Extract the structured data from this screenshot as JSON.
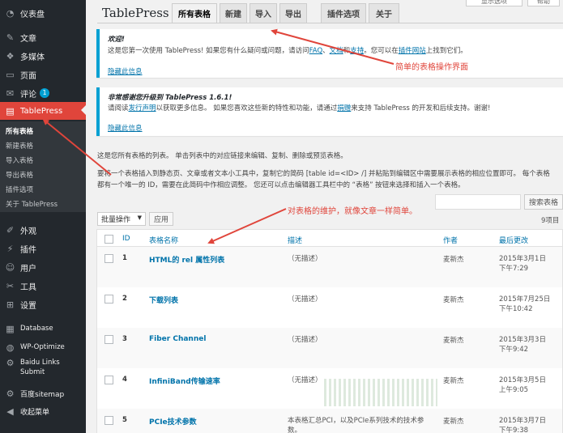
{
  "sidebar": {
    "items": [
      {
        "label": "仪表盘",
        "icon": "dashboard-icon",
        "glyph": "◔"
      },
      {
        "label": "文章",
        "icon": "pin-icon",
        "glyph": "✎"
      },
      {
        "label": "多媒体",
        "icon": "media-icon",
        "glyph": "❖"
      },
      {
        "label": "页面",
        "icon": "page-icon",
        "glyph": "▭"
      },
      {
        "label": "评论",
        "icon": "comment-icon",
        "glyph": "✉",
        "badge": "1"
      },
      {
        "label": "TablePress",
        "icon": "table-icon",
        "glyph": "▤"
      },
      {
        "label": "外观",
        "icon": "brush-icon",
        "glyph": "✐"
      },
      {
        "label": "插件",
        "icon": "plugin-icon",
        "glyph": "⚡"
      },
      {
        "label": "用户",
        "icon": "user-icon",
        "glyph": "☺"
      },
      {
        "label": "工具",
        "icon": "wrench-icon",
        "glyph": "✂"
      },
      {
        "label": "设置",
        "icon": "settings-icon",
        "glyph": "⊞"
      },
      {
        "label": "Database",
        "icon": "database-icon",
        "glyph": "▦"
      },
      {
        "label": "WP-Optimize",
        "icon": "optimize-icon",
        "glyph": "◍"
      },
      {
        "label": "Baidu Links",
        "label2": "Submit",
        "icon": "gear-icon",
        "glyph": "⚙"
      },
      {
        "label": "百度sitemap",
        "icon": "gear-icon",
        "glyph": "⚙"
      },
      {
        "label": "收起菜单",
        "icon": "collapse-icon",
        "glyph": "◀"
      }
    ],
    "submenu": [
      "所有表格",
      "新建表格",
      "导入表格",
      "导出表格",
      "插件选项",
      "关于 TablePress"
    ]
  },
  "top": {
    "title": "TablePress",
    "tabs": [
      "所有表格",
      "新建",
      "导入",
      "导出",
      "插件选项",
      "关于"
    ],
    "screen_options": "显示选项",
    "help": "帮助"
  },
  "notice1": {
    "title": "欢迎!",
    "text_a": "这是您第一次使用 TablePress! 如果您有什么疑问或问题，请访问",
    "link_faq": "FAQ",
    "text_b": "、",
    "link_docs": "文档",
    "text_c": "和",
    "link_support": "支持",
    "text_d": "。您可以在",
    "link_plugin": "插件网站",
    "text_e": "上找到它们。",
    "dismiss": "隐藏此信息"
  },
  "notice2": {
    "title": "非常感谢您升级到 TablePress 1.6.1!",
    "text_a": "请阅读",
    "link_release": "发行声明",
    "text_b": "以获取更多信息。 如果您喜欢这些新的特性和功能，请通过",
    "link_donate": "捐赠",
    "text_c": "来支持 TablePress 的开发和后续支持。谢谢!",
    "dismiss": "隐藏此信息"
  },
  "description": {
    "line1": "这是您所有表格的列表。 单击列表中的对应链接来编辑、复制、删除或预览表格。",
    "line2": "要将一个表格插入到静态页、文章或者文本小工具中，复制它的简码 [table id=<ID> /] 并粘贴到编辑区中需要展示表格的相应位置即可。 每个表格",
    "line3": "都有一个唯一的 ID，需要在此简码中作相应调整。 您还可以点击编辑器工具栏中的 “表格” 按钮来选择和插入一个表格。"
  },
  "controls": {
    "search_button": "搜索表格",
    "bulk_action": "批量操作",
    "apply": "应用",
    "count": "9项目"
  },
  "table": {
    "headers": {
      "id": "ID",
      "name": "表格名称",
      "desc": "描述",
      "author": "作者",
      "modified": "最后更改"
    },
    "rows": [
      {
        "id": "1",
        "name": "HTML的 rel 属性列表",
        "desc": "（无描述）",
        "author": "麦新杰",
        "date": "2015年3月1日",
        "time": "下午7:29"
      },
      {
        "id": "2",
        "name": "下载列表",
        "desc": "（无描述）",
        "author": "麦新杰",
        "date": "2015年7月25日",
        "time": "下午10:42"
      },
      {
        "id": "3",
        "name": "Fiber Channel",
        "desc": "（无描述）",
        "author": "麦新杰",
        "date": "2015年3月3日",
        "time": "下午9:42"
      },
      {
        "id": "4",
        "name": "InfiniBand传输速率",
        "desc": "（无描述）",
        "author": "麦新杰",
        "date": "2015年3月5日",
        "time": "上午9:05"
      },
      {
        "id": "5",
        "name": "PCIe技术参数",
        "desc": "本表格汇总PCI，以及PCIe系列技术的技术参数。",
        "author": "麦新杰",
        "date": "2015年3月7日",
        "time": "下午9:38"
      }
    ]
  },
  "annotations": {
    "simple_ui": "简单的表格操作界面",
    "maintain": "对表格的维护，就像文章一样简单。",
    "color": "#e0453b"
  }
}
